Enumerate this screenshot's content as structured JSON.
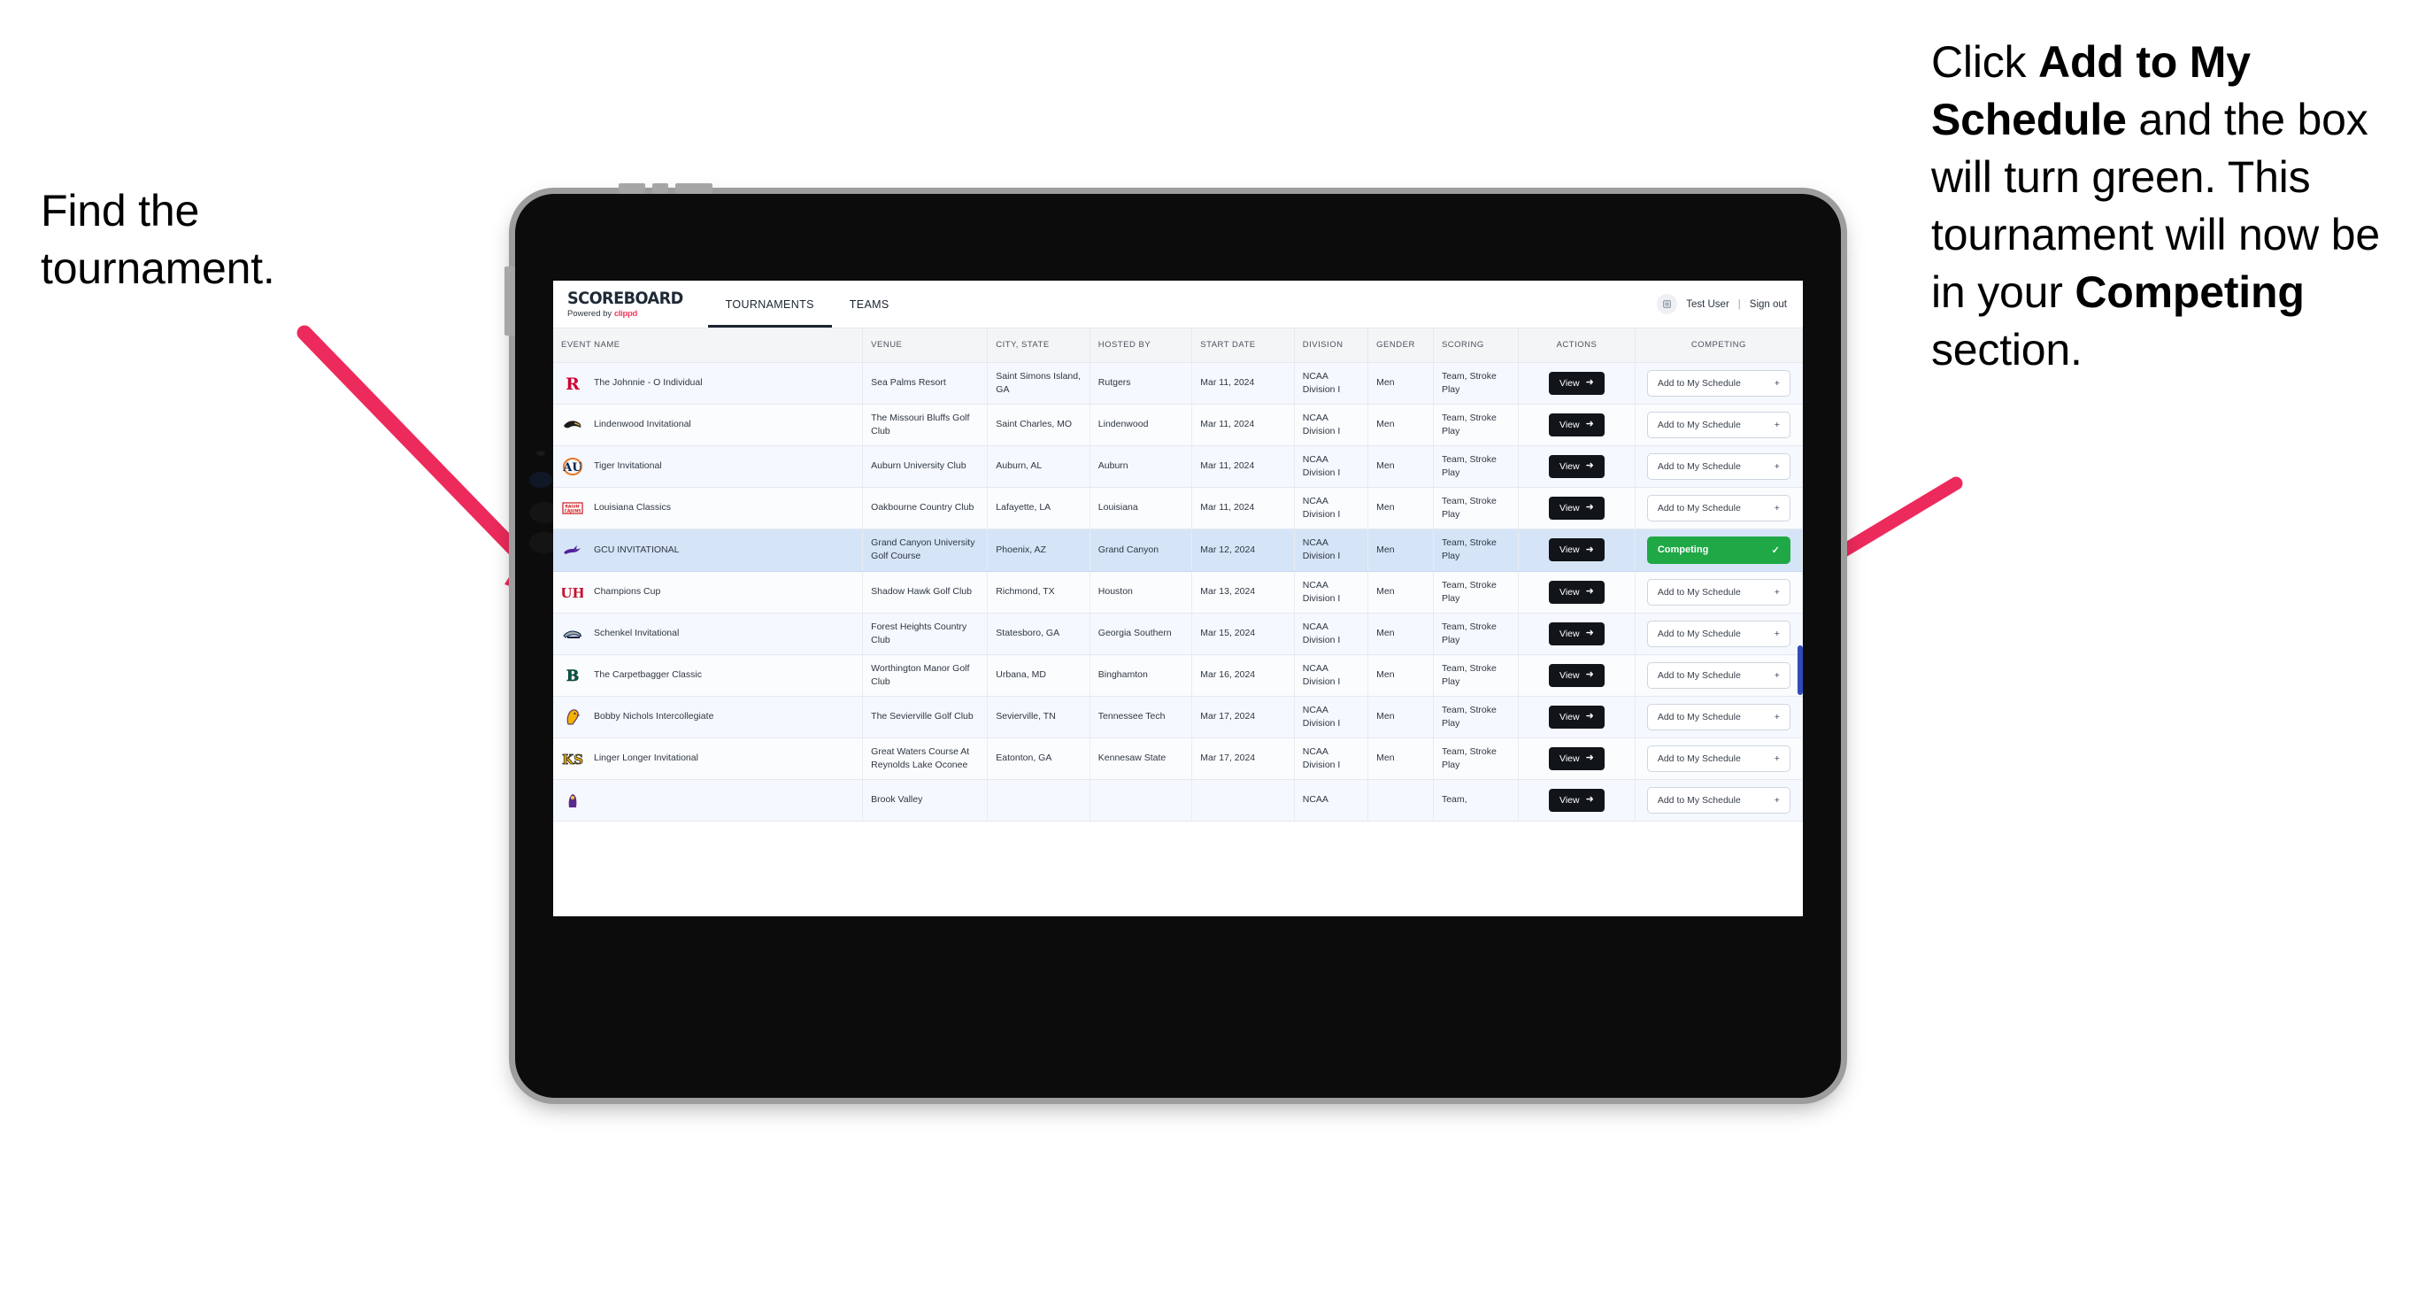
{
  "annotations": {
    "left": {
      "line1": "Find the",
      "line2": "tournament."
    },
    "right": {
      "p1_pre": "Click ",
      "p1_bold": "Add to My Schedule",
      "p1_post": " and the box will turn green. This tournament will now be in your ",
      "p1_bold2": "Competing",
      "p1_end": " section."
    }
  },
  "app": {
    "brand": {
      "title": "SCOREBOARD",
      "powered_prefix": "Powered by ",
      "powered_brand": "clippd",
      "brand_color": "#ef3b5b"
    },
    "nav": [
      {
        "label": "TOURNAMENTS",
        "active": true
      },
      {
        "label": "TEAMS",
        "active": false
      }
    ],
    "account": {
      "avatar_icon": "user-avatar-icon",
      "user": "Test User",
      "separator": "|",
      "signout": "Sign out"
    }
  },
  "table": {
    "columns": [
      "EVENT NAME",
      "VENUE",
      "CITY, STATE",
      "HOSTED BY",
      "START DATE",
      "DIVISION",
      "GENDER",
      "SCORING",
      "ACTIONS",
      "COMPETING"
    ],
    "action_labels": {
      "view": "View",
      "view_icon": "arrow-right-circle-icon",
      "add": "Add to My Schedule",
      "add_icon": "plus-icon",
      "competing": "Competing",
      "competing_icon": "check-icon",
      "competing_color": "#1fa845"
    },
    "rows": [
      {
        "logo": "rutgers-logo",
        "event": "The Johnnie - O Individual",
        "venue": "Sea Palms Resort",
        "city": "Saint Simons Island, GA",
        "hosted": "Rutgers",
        "date": "Mar 11, 2024",
        "division": "NCAA Division I",
        "gender": "Men",
        "scoring": "Team, Stroke Play",
        "competing": false
      },
      {
        "logo": "lindenwood-logo",
        "event": "Lindenwood Invitational",
        "venue": "The Missouri Bluffs Golf Club",
        "city": "Saint Charles, MO",
        "hosted": "Lindenwood",
        "date": "Mar 11, 2024",
        "division": "NCAA Division I",
        "gender": "Men",
        "scoring": "Team, Stroke Play",
        "competing": false
      },
      {
        "logo": "auburn-logo",
        "event": "Tiger Invitational",
        "venue": "Auburn University Club",
        "city": "Auburn, AL",
        "hosted": "Auburn",
        "date": "Mar 11, 2024",
        "division": "NCAA Division I",
        "gender": "Men",
        "scoring": "Team, Stroke Play",
        "competing": false
      },
      {
        "logo": "louisiana-ragin-cajuns-logo",
        "event": "Louisiana Classics",
        "venue": "Oakbourne Country Club",
        "city": "Lafayette, LA",
        "hosted": "Louisiana",
        "date": "Mar 11, 2024",
        "division": "NCAA Division I",
        "gender": "Men",
        "scoring": "Team, Stroke Play",
        "competing": false
      },
      {
        "logo": "grand-canyon-lopes-logo",
        "event": "GCU INVITATIONAL",
        "venue": "Grand Canyon University Golf Course",
        "city": "Phoenix, AZ",
        "hosted": "Grand Canyon",
        "date": "Mar 12, 2024",
        "division": "NCAA Division I",
        "gender": "Men",
        "scoring": "Team, Stroke Play",
        "competing": true
      },
      {
        "logo": "houston-cougars-logo",
        "event": "Champions Cup",
        "venue": "Shadow Hawk Golf Club",
        "city": "Richmond, TX",
        "hosted": "Houston",
        "date": "Mar 13, 2024",
        "division": "NCAA Division I",
        "gender": "Men",
        "scoring": "Team, Stroke Play",
        "competing": false
      },
      {
        "logo": "georgia-southern-eagles-logo",
        "event": "Schenkel Invitational",
        "venue": "Forest Heights Country Club",
        "city": "Statesboro, GA",
        "hosted": "Georgia Southern",
        "date": "Mar 15, 2024",
        "division": "NCAA Division I",
        "gender": "Men",
        "scoring": "Team, Stroke Play",
        "competing": false
      },
      {
        "logo": "binghamton-bearcats-logo",
        "event": "The Carpetbagger Classic",
        "venue": "Worthington Manor Golf Club",
        "city": "Urbana, MD",
        "hosted": "Binghamton",
        "date": "Mar 16, 2024",
        "division": "NCAA Division I",
        "gender": "Men",
        "scoring": "Team, Stroke Play",
        "competing": false
      },
      {
        "logo": "tennessee-tech-golden-eagles-logo",
        "event": "Bobby Nichols Intercollegiate",
        "venue": "The Sevierville Golf Club",
        "city": "Sevierville, TN",
        "hosted": "Tennessee Tech",
        "date": "Mar 17, 2024",
        "division": "NCAA Division I",
        "gender": "Men",
        "scoring": "Team, Stroke Play",
        "competing": false
      },
      {
        "logo": "kennesaw-state-owls-logo",
        "event": "Linger Longer Invitational",
        "venue": "Great Waters Course At Reynolds Lake Oconee",
        "city": "Eatonton, GA",
        "hosted": "Kennesaw State",
        "date": "Mar 17, 2024",
        "division": "NCAA Division I",
        "gender": "Men",
        "scoring": "Team, Stroke Play",
        "competing": false
      },
      {
        "logo": "east-carolina-pirates-logo",
        "event": "",
        "venue": "Brook Valley",
        "city": "",
        "hosted": "",
        "date": "",
        "division": "NCAA",
        "gender": "",
        "scoring": "Team,",
        "competing": false
      }
    ]
  }
}
